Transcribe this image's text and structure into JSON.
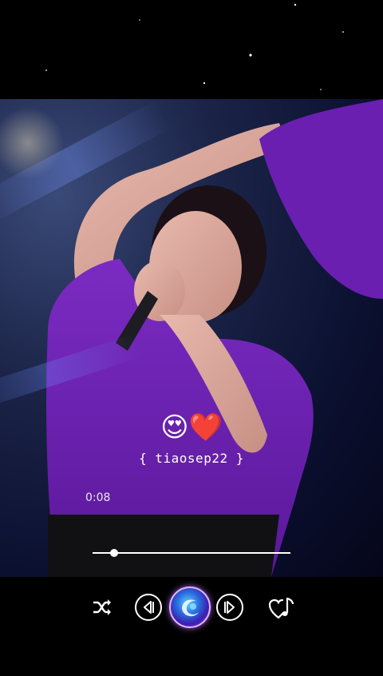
{
  "overlay": {
    "emojis": "😍❤️",
    "handle": "{ tiaosep22 }"
  },
  "player": {
    "elapsed": "0:08",
    "progress": 0.11
  },
  "controls": {
    "shuffle_icon": "shuffle-icon",
    "prev_icon": "previous-icon",
    "play_icon": "play-pause-orb-icon",
    "next_icon": "next-icon",
    "fav_icon": "heart-music-icon"
  },
  "colors": {
    "accent": "#b86bff",
    "background": "#000000"
  }
}
